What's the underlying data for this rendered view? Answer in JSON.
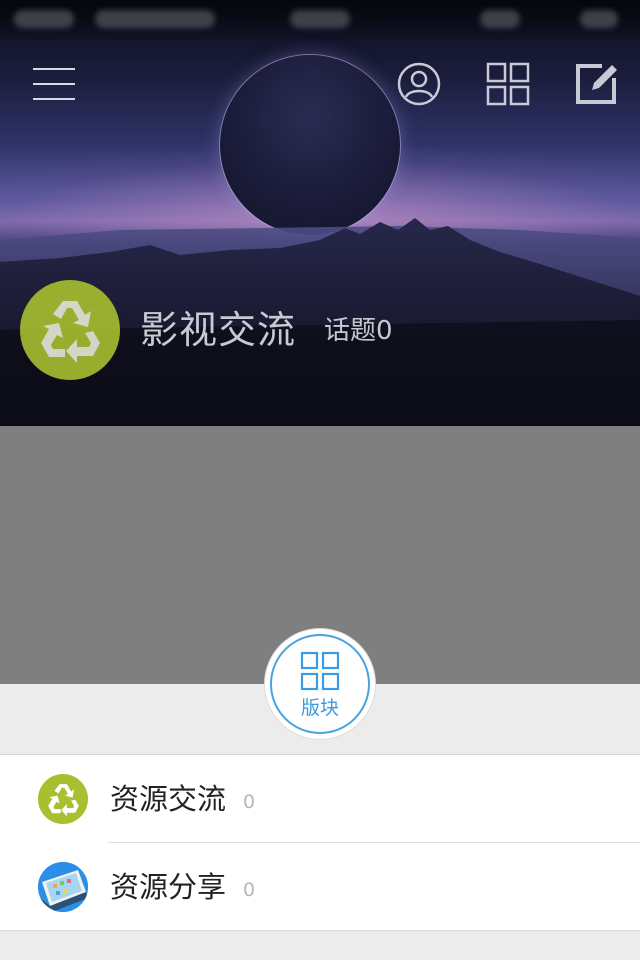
{
  "header": {
    "menu_icon": "hamburger-menu-icon",
    "profile_icon": "user-circle-icon",
    "grid_icon": "grid-icon",
    "compose_icon": "compose-edit-icon"
  },
  "forum": {
    "title": "影视交流",
    "topic_label": "话题0",
    "logo_icon": "recycle-icon",
    "logo_color": "#a8bf2f"
  },
  "picker": {
    "button_label": "版块",
    "button_icon": "grid-icon",
    "accent": "#3a9be0"
  },
  "boards": [
    {
      "name": "资源交流",
      "count": "0",
      "icon": "recycle-icon"
    },
    {
      "name": "资源分享",
      "count": "0",
      "icon": "phone-icon"
    }
  ]
}
